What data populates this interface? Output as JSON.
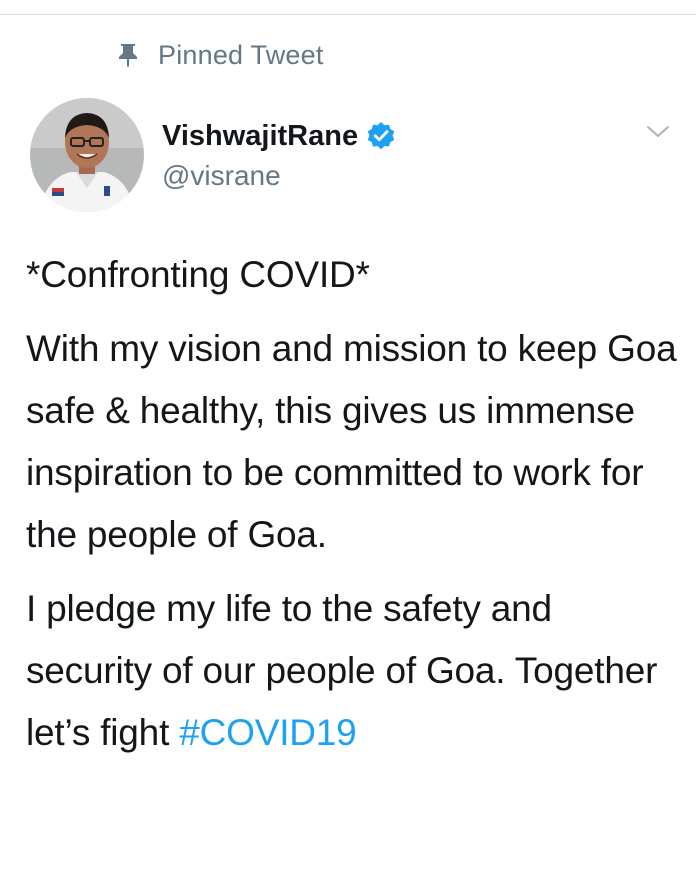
{
  "header": {
    "pinned_label": "Pinned Tweet",
    "pin_icon": "pin-icon"
  },
  "author": {
    "display_name": "VishwajitRane",
    "handle": "@visrane",
    "verified_icon": "verified-badge-icon",
    "avatar_icon": "user-avatar"
  },
  "tweet": {
    "title": "*Confronting COVID*",
    "paragraph_1": "With my vision and mission to keep Goa safe & healthy, this gives us immense inspiration to be committed to work for the people of Goa.",
    "paragraph_2": "I pledge my life to the safety and security of our people of Goa. Together let’s fight ",
    "hashtag": "#COVID19"
  },
  "colors": {
    "accent": "#1da1f2",
    "text": "#14171a",
    "secondary_text": "#657786",
    "background": "#ffffff"
  },
  "menu": {
    "chevron_icon": "chevron-down-icon"
  }
}
